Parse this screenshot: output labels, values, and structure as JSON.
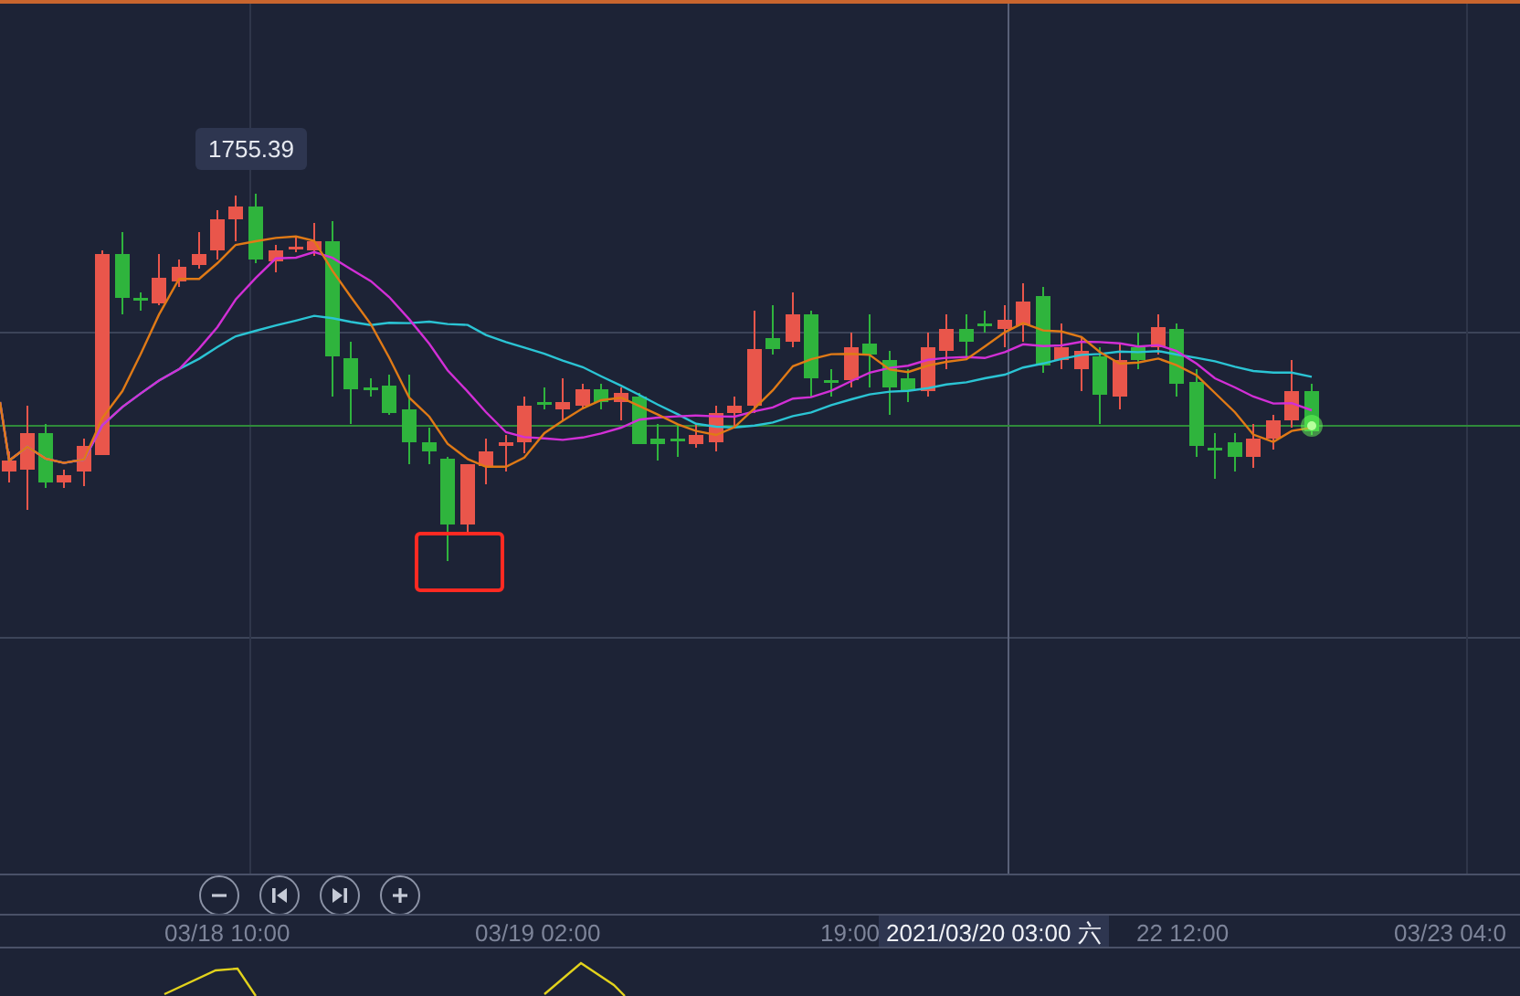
{
  "chart": {
    "price_label": "1755.39"
  },
  "x_axis": {
    "labels": [
      "03/18 10:00",
      "03/19 02:00",
      "19:00",
      "22 12:00",
      "03/23 04:0"
    ],
    "crosshair_label": "2021/03/20 03:00 六"
  }
}
